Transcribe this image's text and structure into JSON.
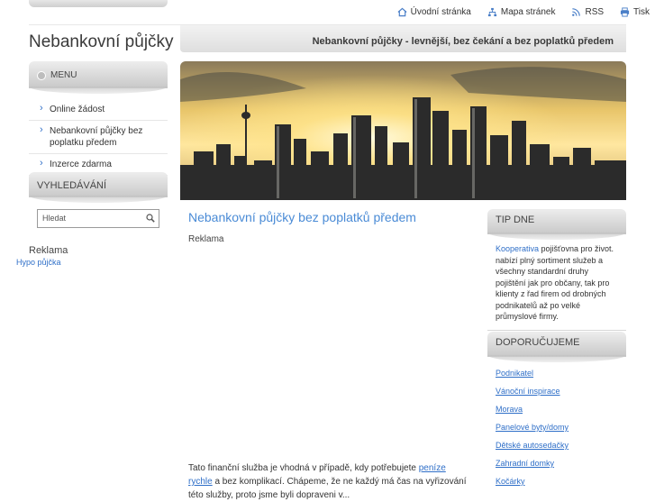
{
  "toplinks": {
    "home": "Úvodní stránka",
    "sitemap": "Mapa stránek",
    "rss": "RSS",
    "print": "Tisk"
  },
  "site_title": "Nebankovní půjčky",
  "slogan": "Nebankovní půjčky - levnější, bez čekání a bez poplatků předem",
  "menu": {
    "title": "MENU",
    "items": [
      {
        "label": "Online žádost"
      },
      {
        "label": "Nebankovní půjčky bez poplatku předem"
      },
      {
        "label": "Inzerce zdarma"
      }
    ]
  },
  "search": {
    "title": "VYHLEDÁVÁNÍ",
    "placeholder": "Hledat"
  },
  "left_ad": {
    "title": "Reklama",
    "link": "Hypo půjčka"
  },
  "article": {
    "title": "Nebankovní půjčky bez poplatků předem",
    "ad_label": "Reklama",
    "text_before": "Tato finanční služba je vhodná v případě, kdy potřebujete ",
    "link": "peníze rychle",
    "text_after": " a bez komplikací. Chápeme, že ne každý má čas na vyřizování této služby, proto jsme byli dopraveni v... "
  },
  "tip": {
    "title": "TIP DNE",
    "link": "Kooperativa",
    "text": " pojišťovna pro život. nabízí plný sortiment služeb a všechny standardní druhy pojištění jak pro občany, tak pro klienty z řad firem od drobných podnikatelů až po velké průmyslové firmy."
  },
  "recommend": {
    "title": "DOPORUČUJEME",
    "items": [
      {
        "label": "Podnikatel"
      },
      {
        "label": "Vánoční inspirace"
      },
      {
        "label": "Morava"
      },
      {
        "label": "Panelové byty/domy"
      },
      {
        "label": "Dětské autosedačky"
      },
      {
        "label": "Zahradní domky"
      },
      {
        "label": "Kočárky"
      }
    ]
  },
  "colors": {
    "link": "#2f6fc8",
    "article_title": "#4a8bd6"
  }
}
